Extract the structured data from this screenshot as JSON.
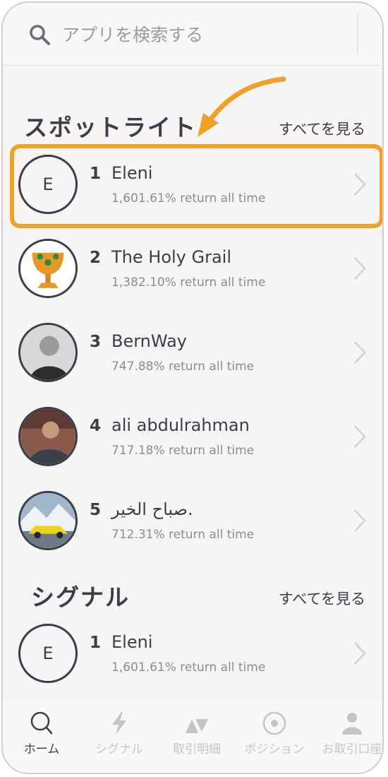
{
  "search": {
    "placeholder": "アプリを検索する"
  },
  "spotlight": {
    "title": "スポットライト",
    "see_all": "すべてを見る",
    "items": [
      {
        "rank": "1",
        "name": "Eleni",
        "return": "1,601.61% return all time",
        "avatar_initial": "E"
      },
      {
        "rank": "2",
        "name": "The Holy Grail",
        "return": "1,382.10% return all time"
      },
      {
        "rank": "3",
        "name": "BernWay",
        "return": "747.88% return all time"
      },
      {
        "rank": "4",
        "name": "ali abdulrahman",
        "return": "717.18% return all time"
      },
      {
        "rank": "5",
        "name": "صباح الخير.",
        "return": "712.31% return all time"
      }
    ]
  },
  "signals": {
    "title": "シグナル",
    "see_all": "すべてを見る",
    "items": [
      {
        "rank": "1",
        "name": "Eleni",
        "return": "1,601.61% return all time",
        "avatar_initial": "E"
      }
    ]
  },
  "tabbar": {
    "items": [
      {
        "label": "ホーム",
        "icon": "search-icon",
        "active": true
      },
      {
        "label": "シグナル",
        "icon": "lightning-icon",
        "active": false
      },
      {
        "label": "取引明細",
        "icon": "triangles-icon",
        "active": false
      },
      {
        "label": "ポジション",
        "icon": "target-icon",
        "active": false
      },
      {
        "label": "お取引口座",
        "icon": "person-icon",
        "active": false
      }
    ]
  },
  "colors": {
    "highlight": "#f2a127",
    "text_dark": "#3b3e4a",
    "text_muted": "#8a8c92",
    "tab_inactive": "#c3c5c9",
    "background": "#f5f5f5"
  }
}
